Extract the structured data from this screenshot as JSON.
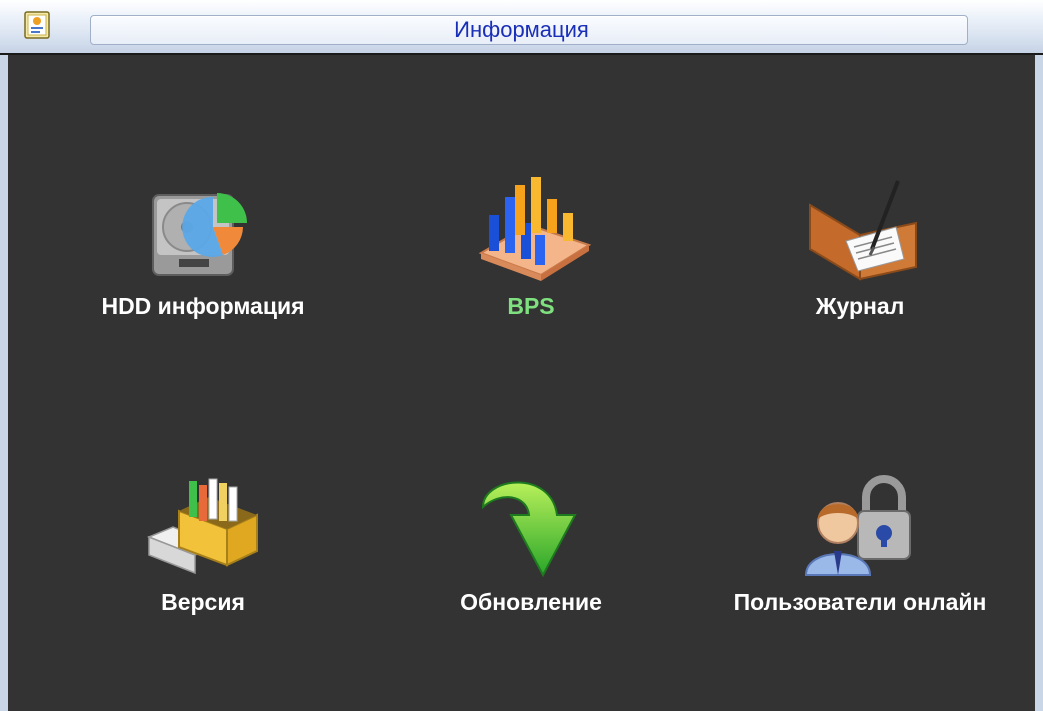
{
  "window": {
    "title": "Информация"
  },
  "menu": {
    "items": [
      {
        "label": "HDD информация",
        "icon": "hdd-info-icon",
        "selected": false
      },
      {
        "label": "BPS",
        "icon": "bps-chart-icon",
        "selected": true
      },
      {
        "label": "Журнал",
        "icon": "journal-log-icon",
        "selected": false
      },
      {
        "label": "Версия",
        "icon": "version-drawer-icon",
        "selected": false
      },
      {
        "label": "Обновление",
        "icon": "update-arrow-icon",
        "selected": false
      },
      {
        "label": "Пользователи онлайн",
        "icon": "online-users-lock-icon",
        "selected": false
      }
    ]
  },
  "colors": {
    "title_text": "#1a2fb8",
    "selected_label": "#7fe07f",
    "label": "#ffffff",
    "background": "#333333"
  }
}
